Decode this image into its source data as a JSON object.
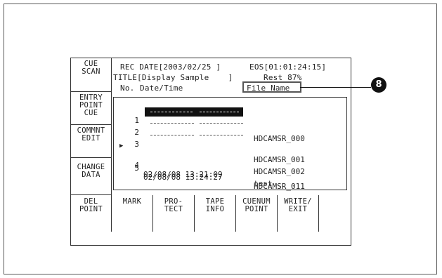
{
  "left_menu": [
    {
      "label": "CUE\nSCAN"
    },
    {
      "label": "ENTRY\nPOINT\nCUE"
    },
    {
      "label": "COMMNT\nEDIT"
    },
    {
      "label": "CHANGE\nDATA"
    }
  ],
  "bottom_menu": [
    {
      "label": "DEL\nPOINT"
    },
    {
      "label": "MARK"
    },
    {
      "label": "PRO-\nTECT"
    },
    {
      "label": "TAPE\nINFO"
    },
    {
      "label": "CUENUM\nPOINT"
    },
    {
      "label": "WRITE/\nEXIT"
    },
    {
      "label": ""
    }
  ],
  "header": {
    "rec_date": "REC DATE[2003/02/25 ]",
    "eos": "EOS[01:01:24:15]",
    "title": "TITLE[Display Sample    ]",
    "rest": "Rest 87%",
    "col_no": "No.",
    "col_datetime": "Date/Time",
    "col_filename": "File Name"
  },
  "rows": [
    {
      "no": "1",
      "date": "",
      "name": "HDCAMSR_000",
      "selected": true,
      "dashed": true
    },
    {
      "no": "2",
      "date": "",
      "name": "HDCAMSR_001",
      "selected": false,
      "dashed": true
    },
    {
      "no": "3",
      "date": "",
      "name": "HDCAMSR_002",
      "selected": false,
      "dashed": true
    },
    {
      "no": "4",
      "date": "02/08/08 13:21:09",
      "name": "test",
      "selected": false,
      "dashed": false,
      "cursor": true
    },
    {
      "no": "5",
      "date": "02/08/08 13:24:27",
      "name": "HDCAMSR_011",
      "selected": false,
      "dashed": false
    }
  ],
  "callout": {
    "label": "8"
  }
}
